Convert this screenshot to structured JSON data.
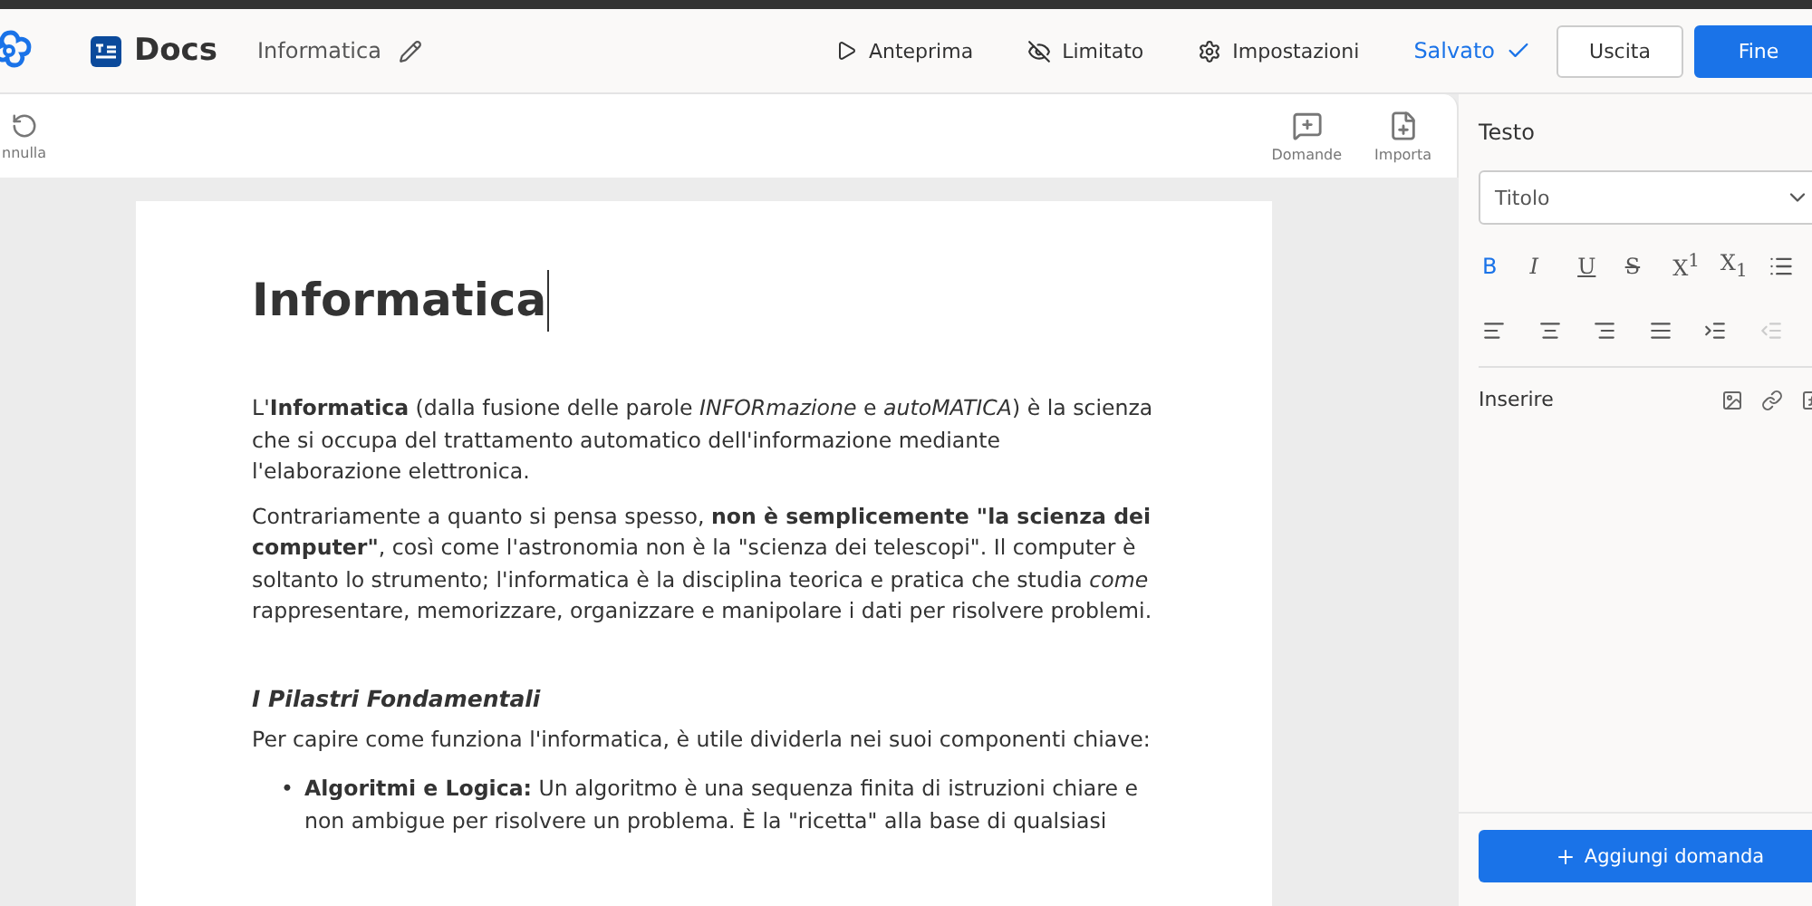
{
  "header": {
    "app_name": "Docs",
    "doc_title": "Informatica",
    "actions": [
      {
        "kind": "preview",
        "label": "Anteprima"
      },
      {
        "kind": "restricted",
        "label": "Limitato"
      },
      {
        "kind": "settings",
        "label": "Impostazioni"
      }
    ],
    "save_status": "Salvato",
    "buttons": [
      {
        "kind": "secondary",
        "label": "Uscita"
      },
      {
        "kind": "primary",
        "label": "Fine"
      }
    ]
  },
  "toolbar": {
    "left": [
      {
        "kind": "undo",
        "label": "nnulla"
      }
    ],
    "right": [
      {
        "kind": "questions",
        "label": "Domande"
      },
      {
        "kind": "import",
        "label": "Importa"
      }
    ]
  },
  "document": {
    "title": "Informatica",
    "blocks": [
      {
        "kind": "paragraph",
        "text": "L'**Informatica** (dalla fusione delle parole *INFORmazione* e *autoMATICA*) è la scienza che si occupa del trattamento automatico dell'informazione mediante l'elaborazione elettronica."
      },
      {
        "kind": "paragraph",
        "text": "Contrariamente a quanto si pensa spesso, **non è semplicemente \"la scienza dei computer\"**, così come l'astronomia non è la \"scienza dei telescopi\". Il computer è soltanto lo strumento; l'informatica è la disciplina teorica e pratica che studia *come* rappresentare, memorizzare, organizzare e manipolare i dati per risolvere problemi."
      },
      {
        "kind": "heading",
        "text": "I Pilastri Fondamentali"
      },
      {
        "kind": "paragraph",
        "text": "Per capire come funziona l'informatica, è utile dividerla nei suoi componenti chiave:"
      },
      {
        "kind": "bullet",
        "marker": "•",
        "text": "**Algoritmi e Logica:** Un algoritmo è una sequenza finita di istruzioni chiare e non ambigue per risolvere un problema. È la \"ricetta\" alla base di qualsiasi"
      }
    ]
  },
  "panel": {
    "section_title": "Testo",
    "style_select": {
      "value": "Titolo"
    },
    "format_buttons": [
      {
        "kind": "bold",
        "label": "B",
        "selected": true
      },
      {
        "kind": "italic",
        "label": "I",
        "selected": false
      },
      {
        "kind": "underline",
        "label": "U",
        "selected": false
      },
      {
        "kind": "strike",
        "label": "S",
        "selected": false
      },
      {
        "kind": "sup",
        "label": "X$^{1}$",
        "selected": false
      },
      {
        "kind": "sub",
        "label": "X$_{1}$",
        "selected": false
      },
      {
        "kind": "list",
        "selected": false
      }
    ],
    "align_buttons": [
      {
        "kind": "left",
        "disabled": false
      },
      {
        "kind": "center",
        "disabled": false
      },
      {
        "kind": "right",
        "disabled": false
      },
      {
        "kind": "justify",
        "disabled": false
      },
      {
        "kind": "indent",
        "disabled": false
      },
      {
        "kind": "outdent",
        "disabled": true
      }
    ],
    "insert_label": "Inserire",
    "add_button": "Aggiungi domanda"
  }
}
